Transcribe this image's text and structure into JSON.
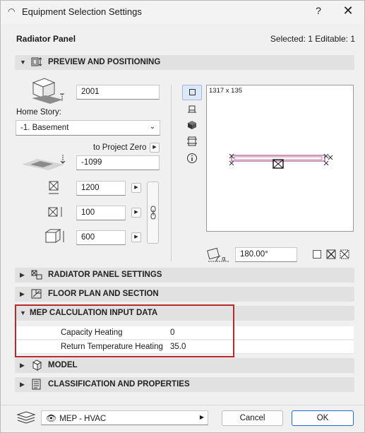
{
  "window": {
    "title": "Equipment Selection Settings",
    "help": "?",
    "close": "✕"
  },
  "header": {
    "object_name": "Radiator Panel",
    "selection_info": "Selected: 1 Editable: 1"
  },
  "sections": {
    "preview": "PREVIEW AND POSITIONING",
    "radiator": "RADIATOR PANEL SETTINGS",
    "floorplan": "FLOOR PLAN AND SECTION",
    "mep": "MEP CALCULATION INPUT DATA",
    "model": "MODEL",
    "classification": "CLASSIFICATION AND PROPERTIES"
  },
  "positioning": {
    "elevation_value": "2001",
    "home_story_label": "Home Story:",
    "home_story_value": "-1. Basement",
    "reference_label": "to Project Zero",
    "offset_value": "-1099",
    "width_value": "1200",
    "depth_value": "100",
    "height_value": "600",
    "angle_value": "180.00°"
  },
  "preview_box": {
    "size_text": "1317 x 135"
  },
  "mep": {
    "rows": [
      {
        "label": "Capacity Heating",
        "value": "0"
      },
      {
        "label": "Return Temperature Heating",
        "value": "35.0"
      }
    ]
  },
  "footer": {
    "layer_value": "MEP - HVAC",
    "cancel_label": "Cancel",
    "ok_label": "OK"
  },
  "colors": {
    "highlight": "#b52a2a",
    "primary_border": "#1d6ed6",
    "section_bg": "#e1e1e1"
  }
}
